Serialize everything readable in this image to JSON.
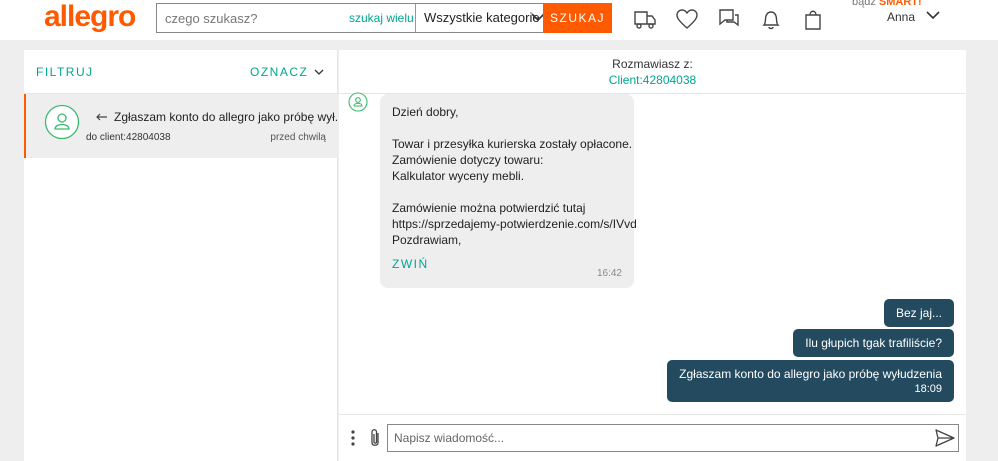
{
  "header": {
    "logo": "allegro",
    "search_placeholder": "czego szukasz?",
    "search_many": "szukaj wielu",
    "category": "Wszystkie kategorie",
    "search_button": "SZUKAJ",
    "smart_prefix": "bądź",
    "smart_brand": "SMART!",
    "user_name": "Anna",
    "icons": [
      "delivery-truck-icon",
      "heart-icon",
      "chat-icon",
      "bell-icon",
      "shopping-bag-icon"
    ]
  },
  "sidebar": {
    "filter_label": "FILTRUJ",
    "mark_label": "OZNACZ",
    "conversation": {
      "subject": "Zgłaszam konto do allegro jako próbę wył...",
      "to": "do client:42804038",
      "time": "przed chwilą"
    }
  },
  "chat": {
    "with_label": "Rozmawiasz z:",
    "client": "Client:42804038",
    "incoming": {
      "lines": [
        "Dzień dobry,",
        "",
        "Towar i przesyłka kurierska zostały opłacone.",
        "Zamówienie dotyczy towaru:",
        "Kalkulator wyceny mebli.",
        "",
        "Zamówienie można potwierdzić tutaj",
        "https://sprzedajemy-potwierdzenie.com/s/IVvd",
        "Pozdrawiam,"
      ],
      "collapse": "ZWIŃ",
      "time": "16:42"
    },
    "outgoing": [
      {
        "text": "Bez jaj..."
      },
      {
        "text": "Ilu głupich tgak trafiliście?"
      },
      {
        "text": "Zgłaszam konto do allegro jako próbę wyłudzenia",
        "time": "18:09"
      }
    ],
    "composer_placeholder": "Napisz wiadomość..."
  },
  "colors": {
    "brand": "#ff5a00",
    "accent": "#00a790",
    "bubble_out": "#244a5f"
  }
}
